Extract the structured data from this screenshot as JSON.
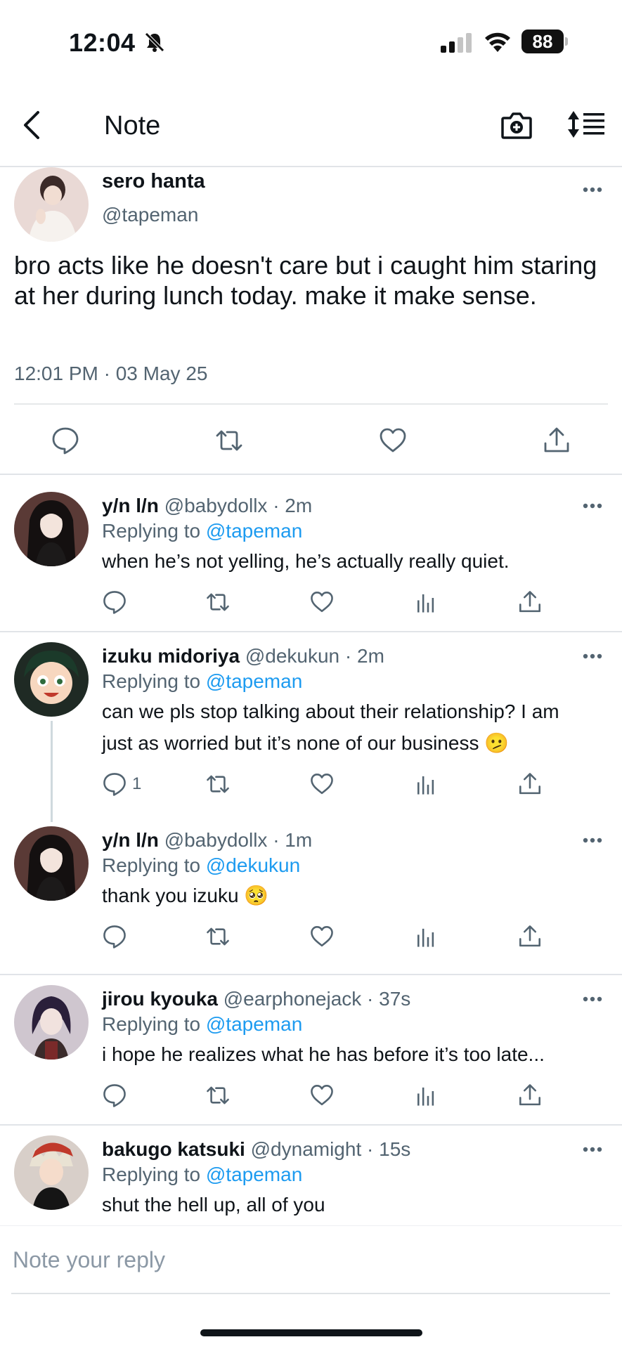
{
  "status_bar": {
    "time": "12:04",
    "battery": "88"
  },
  "header": {
    "title": "Note"
  },
  "main_note": {
    "name": "sero hanta",
    "handle": "@tapeman",
    "text": "bro acts like he doesn't care but i caught him staring at her during lunch today. make it make sense.",
    "timestamp": "12:01 PM · 03 May 25"
  },
  "replies": [
    {
      "name": "y/n l/n",
      "meta": "@babydollx · 2m",
      "replying_prefix": "Replying to ",
      "replying_to": "@tapeman",
      "text": "when he’s not yelling, he’s actually really quiet.",
      "reply_count": ""
    },
    {
      "name": "izuku midoriya",
      "meta": "@dekukun · 2m",
      "replying_prefix": "Replying to ",
      "replying_to": "@tapeman",
      "text": "can we pls stop talking about their relationship? I am just as worried but it’s none of our business 🫤",
      "reply_count": "1"
    },
    {
      "name": "y/n l/n",
      "meta": "@babydollx · 1m",
      "replying_prefix": "Replying to ",
      "replying_to": "@dekukun",
      "text": "thank you izuku 🥺",
      "reply_count": ""
    },
    {
      "name": "jirou kyouka",
      "meta": "@earphonejack · 37s",
      "replying_prefix": "Replying to ",
      "replying_to": "@tapeman",
      "text": "i hope he realizes what he has before it’s too late...",
      "reply_count": ""
    },
    {
      "name": "bakugo katsuki",
      "meta": "@dynamight · 15s",
      "replying_prefix": "Replying to ",
      "replying_to": "@tapeman",
      "text": "shut the hell up, all of you",
      "reply_count": ""
    }
  ],
  "reply_bar": {
    "placeholder": "Note your reply"
  },
  "icons": {
    "back": "chevron-left-icon",
    "camera": "camera-plus-icon",
    "sort": "sort-list-icon",
    "reply": "speech-bubble-icon",
    "repost": "repost-icon",
    "like": "heart-icon",
    "views": "bar-chart-icon",
    "share": "share-icon",
    "more": "more-dots-icon"
  },
  "colors": {
    "accent": "#1d9bf0",
    "muted": "#536471",
    "text": "#0f1419"
  }
}
